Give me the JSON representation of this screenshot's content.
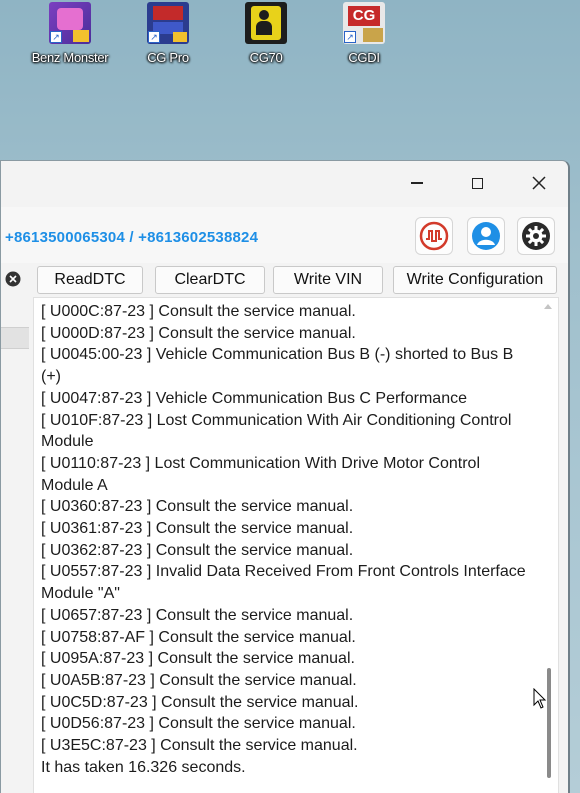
{
  "desktop": {
    "icons": [
      {
        "label": "Benz Monster",
        "icon": "benz-monster-app-icon"
      },
      {
        "label": "CG Pro",
        "icon": "cg-pro-app-icon"
      },
      {
        "label": "CG70",
        "icon": "cg70-app-icon"
      },
      {
        "label": "CGDI",
        "icon": "cgdi-app-icon"
      }
    ]
  },
  "window": {
    "controls": {
      "minimize": "minimize-icon",
      "maximize": "maximize-icon",
      "close": "close-icon"
    },
    "contact": "+8613500065304 / +8613602538824",
    "toolbar_icons": [
      "oscilloscope-icon",
      "user-account-icon",
      "settings-gear-icon"
    ],
    "buttons": {
      "read_dtc": "ReadDTC",
      "clear_dtc": "ClearDTC",
      "write_vin": "Write VIN",
      "write_config": "Write Configuration"
    },
    "log": [
      "[ U000C:87-23 ]  Consult the service manual.",
      "[ U000D:87-23 ]  Consult the service manual.",
      "[ U0045:00-23 ]  Vehicle Communication Bus B (-) shorted to Bus B (+)",
      "[ U0047:87-23 ]  Vehicle Communication Bus C Performance",
      "[ U010F:87-23 ]  Lost Communication With Air Conditioning Control Module",
      "[ U0110:87-23 ]  Lost Communication With Drive Motor Control Module A",
      "[ U0360:87-23 ]  Consult the service manual.",
      "[ U0361:87-23 ]  Consult the service manual.",
      "[ U0362:87-23 ]  Consult the service manual.",
      "[ U0557:87-23 ]  Invalid Data Received From Front Controls Interface Module \"A\"",
      "[ U0657:87-23 ]  Consult the service manual.",
      "[ U0758:87-AF ]  Consult the service manual.",
      "[ U095A:87-23 ]  Consult the service manual.",
      "[ U0A5B:87-23 ]  Consult the service manual.",
      "[ U0C5D:87-23 ]  Consult the service manual.",
      "[ U0D56:87-23 ]  Consult the service manual.",
      "[ U3E5C:87-23 ]  Consult the service manual.",
      "It has taken 16.326 seconds."
    ],
    "colors": {
      "contact": "#1e8fe6",
      "toolbar_red": "#d23a2a",
      "toolbar_blue": "#1f8fe5",
      "toolbar_dark": "#2a2a2a"
    }
  }
}
